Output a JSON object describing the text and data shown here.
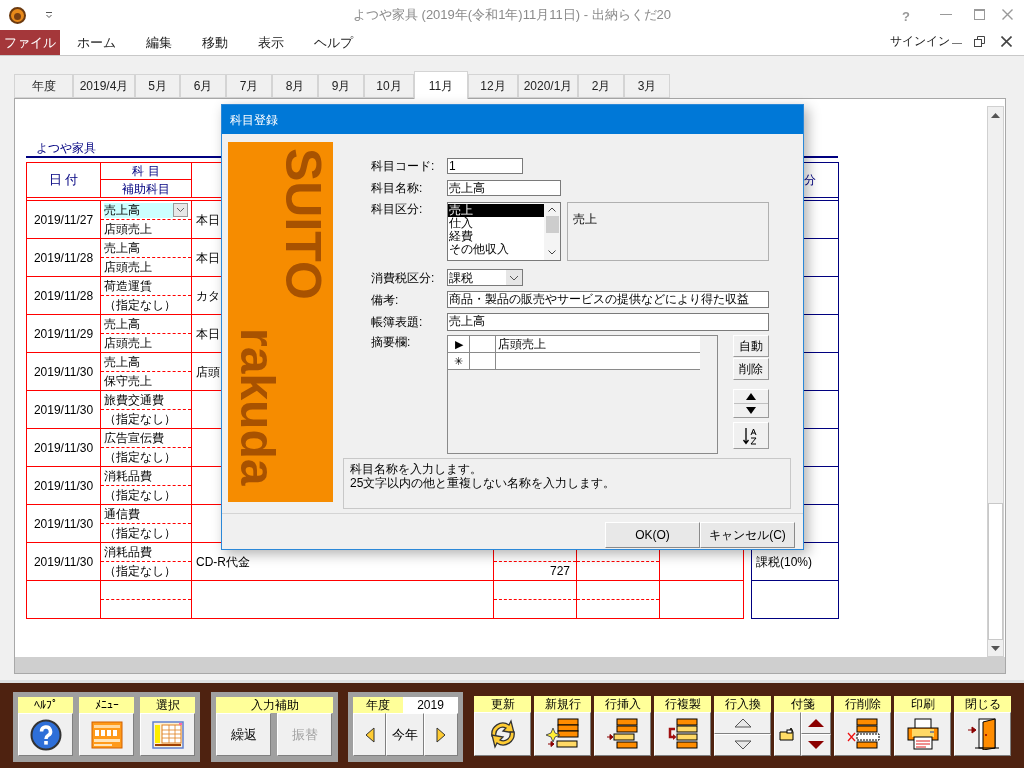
{
  "window": {
    "title": "よつや家具 (2019年(令和1年)11月11日) - 出納らくだ20",
    "help_glyph": "?"
  },
  "menu": [
    {
      "label": "ファイル",
      "selected": true
    },
    {
      "label": "ホーム",
      "selected": false
    },
    {
      "label": "編集",
      "selected": false
    },
    {
      "label": "移動",
      "selected": false
    },
    {
      "label": "表示",
      "selected": false
    },
    {
      "label": "ヘルプ",
      "selected": false
    }
  ],
  "account": {
    "label": "サインイン"
  },
  "month_tabs": [
    {
      "label": "年度",
      "selected": false
    },
    {
      "label": "2019/4月",
      "selected": false
    },
    {
      "label": "5月",
      "selected": false
    },
    {
      "label": "6月",
      "selected": false
    },
    {
      "label": "7月",
      "selected": false
    },
    {
      "label": "8月",
      "selected": false
    },
    {
      "label": "9月",
      "selected": false
    },
    {
      "label": "10月",
      "selected": false
    },
    {
      "label": "11月",
      "selected": true
    },
    {
      "label": "12月",
      "selected": false
    },
    {
      "label": "2020/1月",
      "selected": false
    },
    {
      "label": "2月",
      "selected": false
    },
    {
      "label": "3月",
      "selected": false
    }
  ],
  "ledger": {
    "company": "よつや家具",
    "header": {
      "date": "日 付",
      "account": "科 目",
      "sub_account": "補助科目",
      "tax_column": "分"
    },
    "rows": [
      {
        "date": "2019/11/27",
        "account": "売上高",
        "sub_account": "店頭売上",
        "description": "本日",
        "selected": true
      },
      {
        "date": "2019/11/28",
        "account": "売上高",
        "sub_account": "店頭売上",
        "description": "本日",
        "selected": false
      },
      {
        "date": "2019/11/28",
        "account": "荷造運賃",
        "sub_account": "（指定なし）",
        "description": "カタ",
        "selected": false
      },
      {
        "date": "2019/11/29",
        "account": "売上高",
        "sub_account": "店頭売上",
        "description": "本日",
        "selected": false
      },
      {
        "date": "2019/11/30",
        "account": "売上高",
        "sub_account": "保守売上",
        "description": "店頭",
        "selected": false
      },
      {
        "date": "2019/11/30",
        "account": "旅費交通費",
        "sub_account": "（指定なし）",
        "selected": false
      },
      {
        "date": "2019/11/30",
        "account": "広告宣伝費",
        "sub_account": "（指定なし）",
        "selected": false
      },
      {
        "date": "2019/11/30",
        "account": "消耗品費",
        "sub_account": "（指定なし）",
        "selected": false
      },
      {
        "date": "2019/11/30",
        "account": "通信費",
        "sub_account": "（指定なし）",
        "selected": false
      },
      {
        "date": "2019/11/30",
        "account": "消耗品費",
        "sub_account": "（指定なし）",
        "description": "CD-R代金",
        "amount": "727",
        "tax": "課税(10%)",
        "selected": false
      }
    ]
  },
  "dialog": {
    "title": "科目登録",
    "banner": [
      "SUITO",
      "rakuda"
    ],
    "code": {
      "label": "科目コード:",
      "value": "1"
    },
    "name": {
      "label": "科目名称:",
      "value": "売上高"
    },
    "category": {
      "label": "科目区分:",
      "options": [
        {
          "label": "売上",
          "selected": true
        },
        {
          "label": "仕入",
          "selected": false
        },
        {
          "label": "経費",
          "selected": false
        },
        {
          "label": "その他収入",
          "selected": false
        }
      ],
      "description": "売上"
    },
    "tax": {
      "label": "消費税区分:",
      "value": "課税"
    },
    "note": {
      "label": "備考:",
      "value": "商品・製品の販売やサービスの提供などにより得た収益"
    },
    "book_title": {
      "label": "帳簿表題:",
      "value": "売上高"
    },
    "summary": {
      "label": "摘要欄:",
      "rows": [
        {
          "marker": "▶",
          "text": "店頭売上"
        },
        {
          "marker": "✳"
        }
      ],
      "buttons": [
        "自動",
        "削除"
      ]
    },
    "hint": [
      "科目名称を入力します。",
      "25文字以内の他と重複しない名称を入力します。"
    ],
    "buttons": [
      "OK(O)",
      "キャンセル(C)"
    ]
  },
  "toolbar": {
    "help_group": [
      {
        "label": "ﾍﾙﾌﾟ",
        "kind": "help"
      },
      {
        "label": "ﾒﾆｭｰ",
        "kind": "menu"
      },
      {
        "label": "選択",
        "kind": "select"
      }
    ],
    "input_assist": {
      "label": "入力補助",
      "buttons": [
        {
          "label": "繰返",
          "disabled": false
        },
        {
          "label": "振替",
          "disabled": true
        }
      ]
    },
    "year": {
      "label": "年度",
      "value": "2019",
      "today": "今年"
    },
    "tools": [
      {
        "label": "更新",
        "kind": "refresh"
      },
      {
        "label": "新規行",
        "kind": "add"
      },
      {
        "label": "行挿入",
        "kind": "insert"
      },
      {
        "label": "行複製",
        "kind": "duplicate"
      },
      {
        "label": "行入換",
        "kind": "swap"
      },
      {
        "label": "付箋",
        "kind": "sticky"
      },
      {
        "label": "行削除",
        "kind": "delete"
      },
      {
        "label": "印刷",
        "kind": "print"
      },
      {
        "label": "閉じる",
        "kind": "exit"
      }
    ]
  }
}
